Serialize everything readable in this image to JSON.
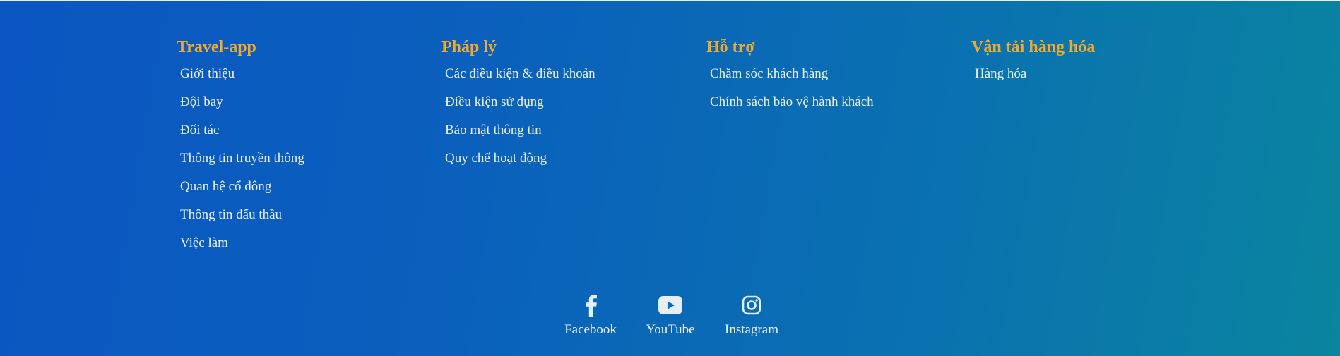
{
  "footer": {
    "columns": [
      {
        "title": "Travel-app",
        "links": [
          "Giới thiệu",
          "Đội bay",
          "Đối tác",
          "Thông tin truyền thông",
          "Quan hệ cổ đông",
          "Thông tin đấu thầu",
          "Việc làm"
        ]
      },
      {
        "title": "Pháp lý",
        "links": [
          "Các điều kiện & điều khoản",
          "Điều kiện sử dụng",
          "Bảo mật thông tin",
          "Quy chế hoạt động"
        ]
      },
      {
        "title": "Hỗ trợ",
        "links": [
          "Chăm sóc khách hàng",
          "Chính sách bảo vệ hành khách"
        ]
      },
      {
        "title": "Vận tải hàng hóa",
        "links": [
          "Hàng hóa"
        ]
      }
    ],
    "socials": [
      {
        "label": "Facebook",
        "icon": "facebook-icon"
      },
      {
        "label": "YouTube",
        "icon": "youtube-icon"
      },
      {
        "label": "Instagram",
        "icon": "instagram-icon"
      }
    ],
    "colors": {
      "heading": "#f0a92d",
      "link": "#eaf1fb",
      "background_start": "#0b56c2",
      "background_end": "#0a849f"
    }
  }
}
